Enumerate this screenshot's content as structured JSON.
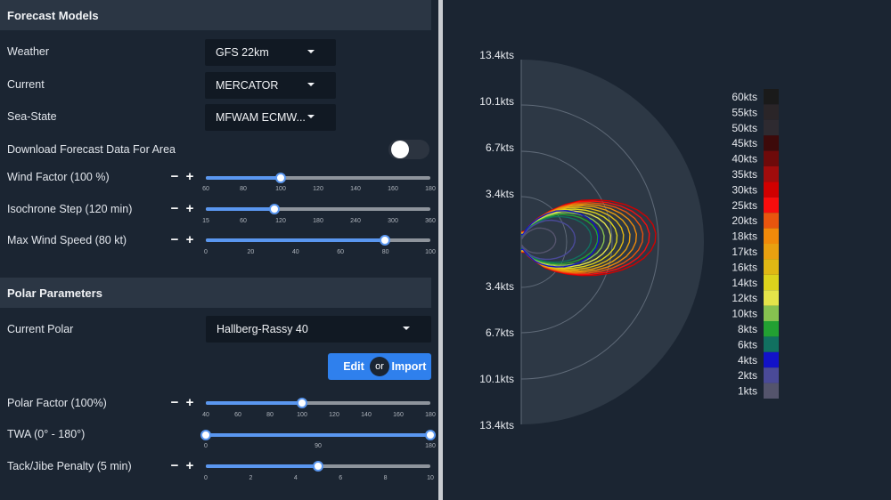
{
  "forecast": {
    "header": "Forecast Models",
    "weather": {
      "label": "Weather",
      "value": "GFS 22km"
    },
    "current": {
      "label": "Current",
      "value": "MERCATOR"
    },
    "seastate": {
      "label": "Sea-State",
      "value": "MFWAM ECMW..."
    },
    "download": {
      "label": "Download Forecast Data For Area",
      "enabled": false
    },
    "wind_factor": {
      "label": "Wind Factor (100 %)",
      "min": 60,
      "max": 180,
      "value": 100,
      "ticks": [
        "60",
        "80",
        "100",
        "120",
        "140",
        "160",
        "180"
      ]
    },
    "isochrone": {
      "label": "Isochrone Step (120 min)",
      "value_fraction": 0.3,
      "ticks": [
        "15",
        "60",
        "120",
        "180",
        "240",
        "300",
        "360"
      ]
    },
    "max_wind": {
      "label": "Max Wind Speed (80 kt)",
      "min": 0,
      "max": 100,
      "value": 80,
      "ticks": [
        "0",
        "20",
        "40",
        "60",
        "80",
        "100"
      ]
    }
  },
  "polar": {
    "header": "Polar Parameters",
    "current_polar": {
      "label": "Current Polar",
      "value": "Hallberg-Rassy 40"
    },
    "edit_label": "Edit",
    "or_label": "or",
    "import_label": "Import",
    "polar_factor": {
      "label": "Polar Factor (100%)",
      "min": 40,
      "max": 180,
      "value": 100,
      "ticks": [
        "40",
        "60",
        "80",
        "100",
        "120",
        "140",
        "160",
        "180"
      ]
    },
    "twa": {
      "label": "TWA (0° - 180°)",
      "min": 0,
      "max": 180,
      "value_low": 0,
      "value_high": 180,
      "ticks": [
        "0",
        "90",
        "180"
      ]
    },
    "tack_penalty": {
      "label": "Tack/Jibe Penalty (5 min)",
      "min": 0,
      "max": 10,
      "value": 5,
      "ticks": [
        "0",
        "2",
        "4",
        "6",
        "8",
        "10"
      ]
    }
  },
  "polar_chart": {
    "ring_labels_top": [
      "13.4kts",
      "10.1kts",
      "6.7kts",
      "3.4kts"
    ],
    "ring_labels_bottom": [
      "3.4kts",
      "6.7kts",
      "10.1kts",
      "13.4kts"
    ],
    "legend": [
      {
        "label": "60kts",
        "color": "#1a1a1a"
      },
      {
        "label": "55kts",
        "color": "#2a2528"
      },
      {
        "label": "50kts",
        "color": "#2e2a30"
      },
      {
        "label": "45kts",
        "color": "#3d0a0a"
      },
      {
        "label": "40kts",
        "color": "#6e0a0a"
      },
      {
        "label": "35kts",
        "color": "#a00c0c"
      },
      {
        "label": "30kts",
        "color": "#d00000"
      },
      {
        "label": "25kts",
        "color": "#f80d0d"
      },
      {
        "label": "20kts",
        "color": "#e8550e"
      },
      {
        "label": "18kts",
        "color": "#f08a0a"
      },
      {
        "label": "17kts",
        "color": "#e8a010"
      },
      {
        "label": "16kts",
        "color": "#e0b814"
      },
      {
        "label": "14kts",
        "color": "#dcd31c"
      },
      {
        "label": "12kts",
        "color": "#e4e44a"
      },
      {
        "label": "10kts",
        "color": "#86c150"
      },
      {
        "label": "8kts",
        "color": "#22a032"
      },
      {
        "label": "6kts",
        "color": "#117060"
      },
      {
        "label": "4kts",
        "color": "#1212c8"
      },
      {
        "label": "2kts",
        "color": "#4a4a98"
      },
      {
        "label": "1kts",
        "color": "#54546c"
      }
    ]
  }
}
